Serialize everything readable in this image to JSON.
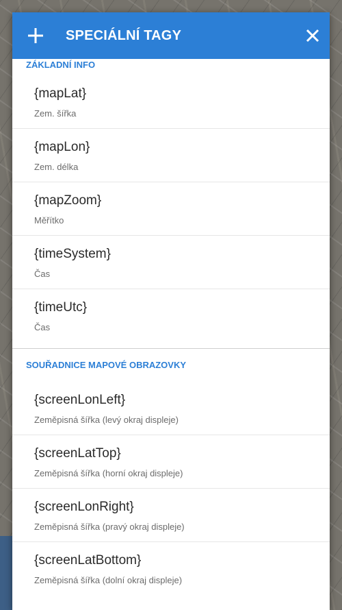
{
  "dialog": {
    "title": "SPECIÁLNÍ TAGY",
    "add_icon": "plus-icon",
    "close_icon": "close-icon"
  },
  "sections": [
    {
      "header": "ZÁKLADNÍ INFO",
      "items": [
        {
          "tag": "{mapLat}",
          "desc": "Zem. šířka"
        },
        {
          "tag": "{mapLon}",
          "desc": "Zem. délka"
        },
        {
          "tag": "{mapZoom}",
          "desc": "Měřítko"
        },
        {
          "tag": "{timeSystem}",
          "desc": "Čas"
        },
        {
          "tag": "{timeUtc}",
          "desc": "Čas"
        }
      ]
    },
    {
      "header": "SOUŘADNICE MAPOVÉ OBRAZOVKY",
      "items": [
        {
          "tag": "{screenLonLeft}",
          "desc": "Zeměpisná šířka (levý okraj displeje)"
        },
        {
          "tag": "{screenLatTop}",
          "desc": "Zeměpisná šířka (horní okraj displeje)"
        },
        {
          "tag": "{screenLonRight}",
          "desc": "Zeměpisná šířka (pravý okraj displeje)"
        },
        {
          "tag": "{screenLatBottom}",
          "desc": "Zeměpisná šířka (dolní okraj displeje)"
        }
      ]
    }
  ],
  "colors": {
    "accent": "#2c7fd6",
    "header_text": "#ffffff",
    "item_title": "#2a2a2a",
    "item_subtitle": "#6b6b6b"
  }
}
